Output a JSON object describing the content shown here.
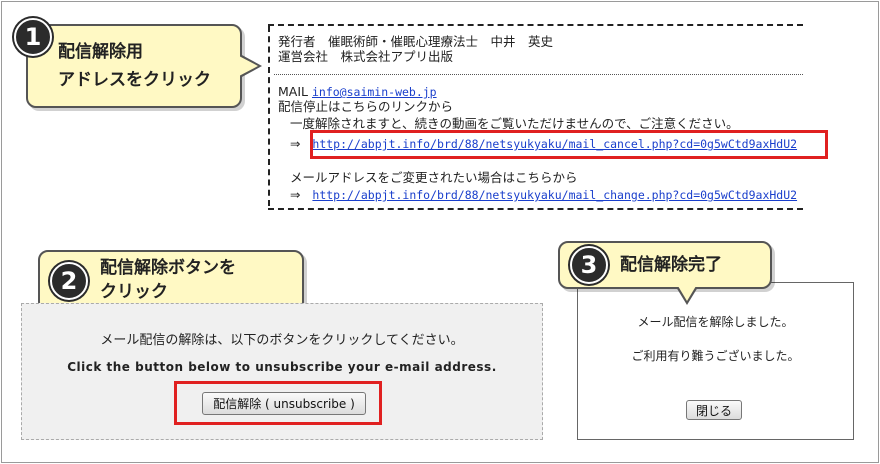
{
  "step1": {
    "number": "1",
    "line1": "配信解除用",
    "line2": "アドレスをクリック"
  },
  "step2": {
    "number": "2",
    "line1": "配信解除ボタンを",
    "line2": "クリック"
  },
  "step3": {
    "number": "3",
    "label": "配信解除完了"
  },
  "email": {
    "publisher": "発行者　催眠術師・催眠心理療法士　中井　英史",
    "company": "運営会社　株式会社アプリ出版",
    "mail_label": "MAIL",
    "mail_address": "info@saimin-web.jp",
    "stop_heading": "配信停止はこちらのリンクから",
    "stop_warning": "一度解除されますと、続きの動画をご覧いただけませんので、ご注意ください。",
    "arrow": "⇒",
    "cancel_url": "http://abpjt.info/brd/88/netsyukyaku/mail_cancel.php?cd=0g5wCtd9axHdU2",
    "change_heading": "メールアドレスをご変更されたい場合はこちらから",
    "change_url": "http://abpjt.info/brd/88/netsyukyaku/mail_change.php?cd=0g5wCtd9axHdU2"
  },
  "unsubscribe_panel": {
    "instruction_jp": "メール配信の解除は、以下のボタンをクリックしてください。",
    "instruction_en": "Click the button below to unsubscribe your e-mail address.",
    "button_label": "配信解除 ( unsubscribe )"
  },
  "complete_panel": {
    "message1": "メール配信を解除しました。",
    "message2": "ご利用有り難うございました。",
    "close_label": "閉じる"
  },
  "colors": {
    "callout_bg": "#fff9c4",
    "highlight": "#e02020",
    "link": "#1a3fcc"
  }
}
